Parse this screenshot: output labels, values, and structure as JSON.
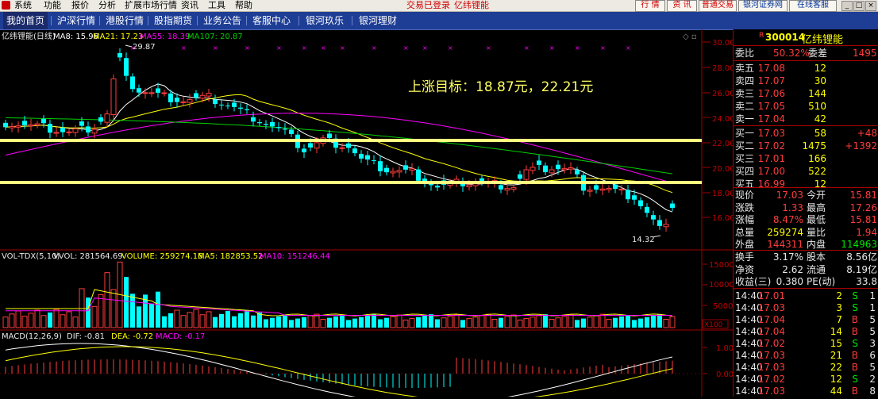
{
  "menubar": {
    "items": [
      "系统",
      "功能",
      "报价",
      "分析",
      "扩展市场行情",
      "资讯",
      "工具",
      "帮助"
    ],
    "status_login": "交易已登录",
    "status_stock": "亿纬锂能",
    "buttons": [
      "行 情",
      "资 讯",
      "普通交易",
      "银河证券网",
      "在线客服"
    ]
  },
  "nav": {
    "items": [
      "我的首页",
      "沪深行情",
      "港股行情",
      "股指期货",
      "业务公告",
      "客服中心",
      "银河玖乐",
      "银河理财"
    ],
    "active_index": 0
  },
  "main_chart": {
    "name": "亿纬锂能(日线)",
    "ma8": "MA8: 15.96",
    "ma21": "MA21: 17.23",
    "ma55": "MA55: 18.39",
    "ma107": "MA107: 20.87",
    "annotation": "上涨目标：18.87元，22.21元",
    "high_label": "29.87",
    "low_label": "14.32",
    "yticks": [
      "30.00",
      "28.00",
      "26.00",
      "24.00",
      "22.00",
      "20.00",
      "18.00",
      "16.00"
    ]
  },
  "vol_chart": {
    "legend_name": "VOL-TDX(5,10)",
    "legend_vvol": "VVOL: 281564.69",
    "legend_volume": "VOLUME: 259274.16",
    "legend_ma5": "MA5: 182853.52",
    "legend_ma10": "MA10: 151246.44",
    "yticks": [
      "15000",
      "10000",
      "5000"
    ],
    "unit": "X100"
  },
  "macd_chart": {
    "legend_name": "MACD(12,26,9)",
    "legend_dif": "DIF: -0.81",
    "legend_dea": "DEA: -0.72",
    "legend_macd": "MACD: -0.17",
    "yticks": [
      "1.00",
      "0.00"
    ]
  },
  "colors": {
    "up": "#ff3c3c",
    "down": "#00ffff",
    "ma8": "#ffffff",
    "ma21": "#ffff00",
    "ma55": "#ff00ff",
    "ma107": "#00d000",
    "grid": "#a00000",
    "nav_bg": "#1e3e96"
  },
  "quote": {
    "code": "300014",
    "name": "亿纬锂能",
    "weibi_label": "委比",
    "weibi": "50.32%",
    "weicha_label": "委差",
    "weicha": "1495",
    "asks": [
      {
        "label": "卖五",
        "price": "17.08",
        "vol": "12"
      },
      {
        "label": "卖四",
        "price": "17.07",
        "vol": "30"
      },
      {
        "label": "卖三",
        "price": "17.06",
        "vol": "144"
      },
      {
        "label": "卖二",
        "price": "17.05",
        "vol": "510"
      },
      {
        "label": "卖一",
        "price": "17.04",
        "vol": "42"
      }
    ],
    "bids": [
      {
        "label": "买一",
        "price": "17.03",
        "vol": "58",
        "chg": "+48"
      },
      {
        "label": "买二",
        "price": "17.02",
        "vol": "1475",
        "chg": "+1392"
      },
      {
        "label": "买三",
        "price": "17.01",
        "vol": "166",
        "chg": ""
      },
      {
        "label": "买四",
        "price": "17.00",
        "vol": "522",
        "chg": ""
      },
      {
        "label": "买五",
        "price": "16.99",
        "vol": "12",
        "chg": ""
      }
    ],
    "stats": [
      {
        "l1": "现价",
        "v1": "17.03",
        "l2": "今开",
        "v2": "15.81"
      },
      {
        "l1": "涨跌",
        "v1": "1.33",
        "l2": "最高",
        "v2": "17.26"
      },
      {
        "l1": "涨幅",
        "v1": "8.47%",
        "l2": "最低",
        "v2": "15.81"
      },
      {
        "l1": "总量",
        "v1": "259274",
        "l2": "量比",
        "v2": "1.94"
      },
      {
        "l1": "外盘",
        "v1": "144311",
        "l2": "内盘",
        "v2": "114963"
      }
    ],
    "stats2": [
      {
        "l1": "换手",
        "v1": "3.17%",
        "l2": "股本",
        "v2": "8.56亿"
      },
      {
        "l1": "净资",
        "v1": "2.62",
        "l2": "流通",
        "v2": "8.19亿"
      },
      {
        "l1": "收益(三)",
        "v1": "0.380",
        "l2": "PE(动)",
        "v2": "33.8"
      }
    ],
    "ticks": [
      {
        "time": "14:40",
        "price": "17.01",
        "vol": "2",
        "side": "S",
        "n": "1"
      },
      {
        "time": "14:40",
        "price": "17.03",
        "vol": "3",
        "side": "S",
        "n": "1"
      },
      {
        "time": "14:40",
        "price": "17.04",
        "vol": "7",
        "side": "B",
        "n": "5"
      },
      {
        "time": "14:40",
        "price": "17.04",
        "vol": "14",
        "side": "B",
        "n": "5"
      },
      {
        "time": "14:40",
        "price": "17.02",
        "vol": "15",
        "side": "S",
        "n": "3"
      },
      {
        "time": "14:40",
        "price": "17.03",
        "vol": "21",
        "side": "B",
        "n": "6"
      },
      {
        "time": "14:40",
        "price": "17.03",
        "vol": "22",
        "side": "B",
        "n": "5"
      },
      {
        "time": "14:40",
        "price": "17.02",
        "vol": "12",
        "side": "S",
        "n": "2"
      },
      {
        "time": "14:40",
        "price": "17.03",
        "vol": "44",
        "side": "B",
        "n": "8"
      }
    ]
  }
}
